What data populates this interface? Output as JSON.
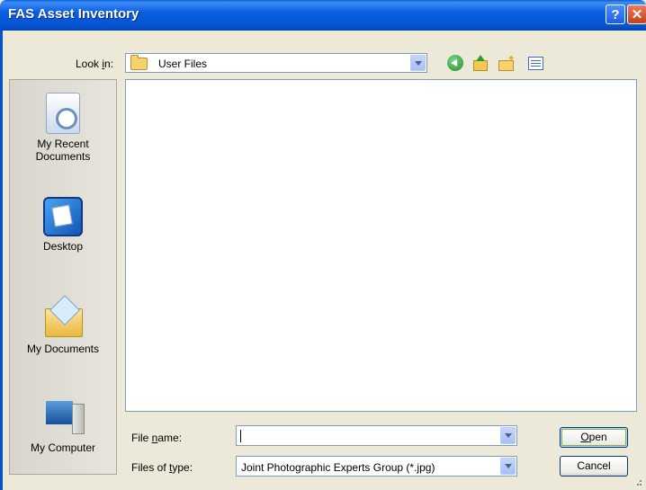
{
  "window": {
    "title": "FAS Asset Inventory",
    "help": "?",
    "close": "✕"
  },
  "lookin": {
    "label_prefix": "Look ",
    "label_accel": "i",
    "label_suffix": "n:",
    "value": "User Files"
  },
  "places": [
    {
      "label": "My Recent Documents",
      "icon": "recent-documents-icon"
    },
    {
      "label": "Desktop",
      "icon": "desktop-icon"
    },
    {
      "label": "My Documents",
      "icon": "my-documents-icon"
    },
    {
      "label": "My Computer",
      "icon": "my-computer-icon"
    }
  ],
  "filename": {
    "label_prefix": "File ",
    "label_accel": "n",
    "label_suffix": "ame:",
    "value": ""
  },
  "filetype": {
    "label_prefix": "Files of ",
    "label_accel": "t",
    "label_suffix": "ype:",
    "value": "Joint Photographic Experts Group (*.jpg)"
  },
  "buttons": {
    "open_accel": "O",
    "open_rest": "pen",
    "cancel": "Cancel"
  },
  "colors": {
    "titlebar": "#0553d0",
    "dialog_bg": "#ece9d8",
    "field_border": "#7f9db9"
  }
}
